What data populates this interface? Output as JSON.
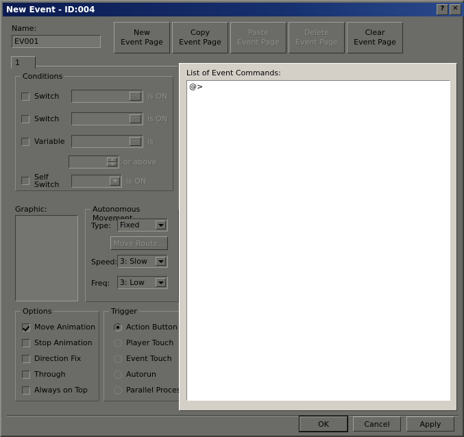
{
  "window": {
    "title": "New Event - ID:004",
    "help_button": "?",
    "close_button": "✕"
  },
  "name_section": {
    "label": "Name:",
    "value": "EV001",
    "placeholder": ""
  },
  "page_buttons": [
    {
      "line1": "New",
      "line2": "Event Page",
      "enabled": true
    },
    {
      "line1": "Copy",
      "line2": "Event Page",
      "enabled": true
    },
    {
      "line1": "Paste",
      "line2": "Event Page",
      "enabled": false
    },
    {
      "line1": "Delete",
      "line2": "Event Page",
      "enabled": false
    },
    {
      "line1": "Clear",
      "line2": "Event Page",
      "enabled": true
    }
  ],
  "tabs": [
    {
      "label": "1",
      "active": true
    }
  ],
  "conditions": {
    "legend": "Conditions",
    "rows": [
      {
        "label": "Switch",
        "checked": false,
        "value": "",
        "suffix": "is ON",
        "browse": "···"
      },
      {
        "label": "Switch",
        "checked": false,
        "value": "",
        "suffix": "is ON",
        "browse": "···"
      },
      {
        "label": "Variable",
        "checked": false,
        "value": "",
        "suffix": "is",
        "browse": "···"
      }
    ],
    "variable_amount": {
      "value": "",
      "suffix": "or above"
    },
    "self_switch": {
      "label1": "Self",
      "label2": "Switch",
      "checked": false,
      "value": "",
      "suffix": "is ON"
    }
  },
  "graphic": {
    "label": "Graphic:"
  },
  "autonomous_movement": {
    "legend": "Autonomous Movement",
    "type_label": "Type:",
    "type_value": "Fixed",
    "move_route_button": "Move Route...",
    "move_route_enabled": false,
    "speed_label": "Speed:",
    "speed_value": "3: Slow",
    "freq_label": "Freq:",
    "freq_value": "3: Low"
  },
  "options": {
    "legend": "Options",
    "items": [
      {
        "label": "Move Animation",
        "checked": true
      },
      {
        "label": "Stop Animation",
        "checked": false
      },
      {
        "label": "Direction Fix",
        "checked": false
      },
      {
        "label": "Through",
        "checked": false
      },
      {
        "label": "Always on Top",
        "checked": false
      }
    ]
  },
  "trigger": {
    "legend": "Trigger",
    "items": [
      {
        "label": "Action Button",
        "selected": true
      },
      {
        "label": "Player Touch",
        "selected": false
      },
      {
        "label": "Event Touch",
        "selected": false
      },
      {
        "label": "Autorun",
        "selected": false
      },
      {
        "label": "Parallel Process",
        "selected": false
      }
    ]
  },
  "commands": {
    "label": "List of Event Commands:",
    "items": [
      "@>"
    ]
  },
  "footer": {
    "ok": "OK",
    "cancel": "Cancel",
    "apply": "Apply"
  },
  "colors": {
    "dialog_face": "#6b6b67",
    "titlebar_start": "#0c1b50",
    "titlebar_end": "#2b4a8c",
    "panel_face": "#d4d0c8",
    "list_background": "#ffffff",
    "disabled_text": "#8e8e89"
  }
}
